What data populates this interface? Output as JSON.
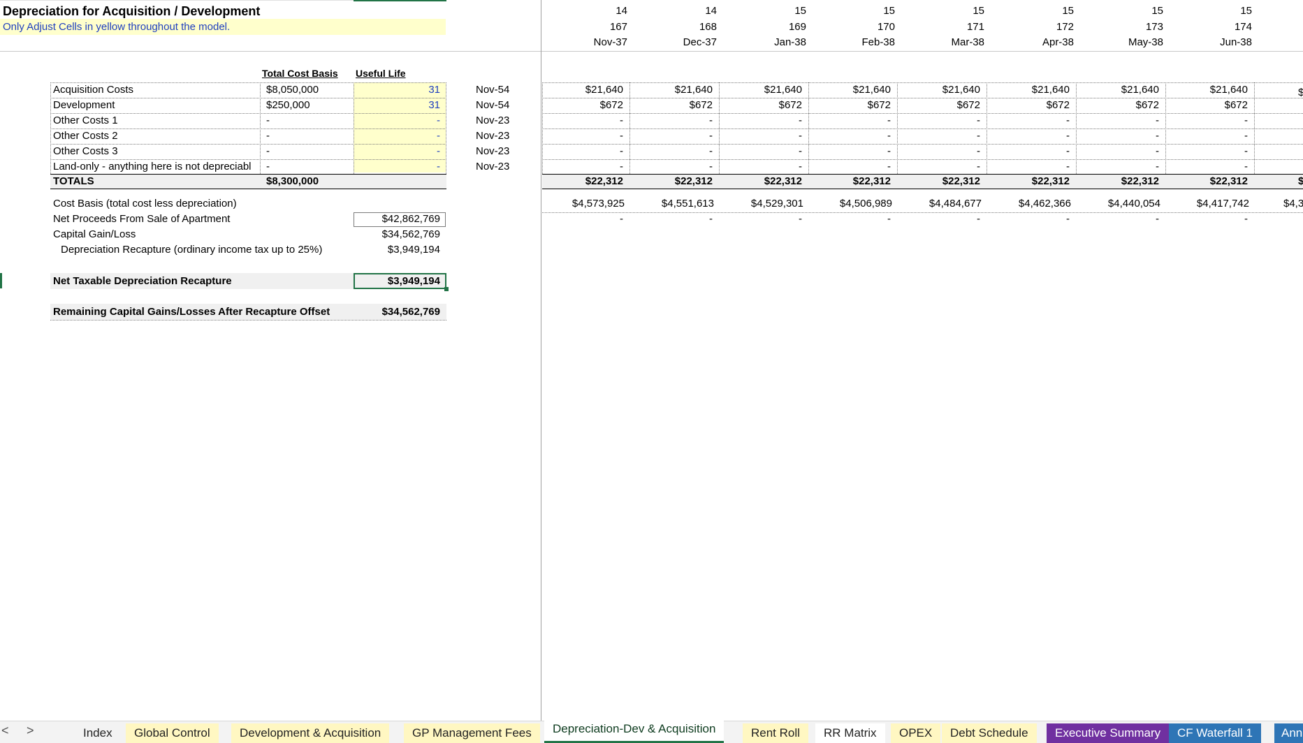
{
  "sheet": {
    "title": "Depreciation for Acquisition / Development",
    "note": "Only Adjust Cells in yellow throughout the model."
  },
  "headers": {
    "total_cost_basis": "Total Cost Basis",
    "useful_life": "Useful Life"
  },
  "periods": [
    {
      "year": "14",
      "month": "167",
      "date": "Nov-37"
    },
    {
      "year": "14",
      "month": "168",
      "date": "Dec-37"
    },
    {
      "year": "15",
      "month": "169",
      "date": "Jan-38"
    },
    {
      "year": "15",
      "month": "170",
      "date": "Feb-38"
    },
    {
      "year": "15",
      "month": "171",
      "date": "Mar-38"
    },
    {
      "year": "15",
      "month": "172",
      "date": "Apr-38"
    },
    {
      "year": "15",
      "month": "173",
      "date": "May-38"
    },
    {
      "year": "15",
      "month": "174",
      "date": "Jun-38"
    }
  ],
  "rows": [
    {
      "label": "Acquisition Costs",
      "basis": "$8,050,000",
      "life": "31",
      "end": "Nov-54",
      "monthly": "$21,640"
    },
    {
      "label": "Development",
      "basis": "$250,000",
      "life": "31",
      "end": "Nov-54",
      "monthly": "$672"
    },
    {
      "label": "Other Costs 1",
      "basis": "-",
      "life": "-",
      "end": "Nov-23",
      "monthly": "-"
    },
    {
      "label": "Other Costs 2",
      "basis": "-",
      "life": "-",
      "end": "Nov-23",
      "monthly": "-"
    },
    {
      "label": "Other Costs 3",
      "basis": "-",
      "life": "-",
      "end": "Nov-23",
      "monthly": "-"
    },
    {
      "label": "Land-only - anything here is not depreciabl",
      "basis": "-",
      "life": "-",
      "end": "Nov-23",
      "monthly": "-"
    }
  ],
  "totals": {
    "label": "TOTALS",
    "basis": "$8,300,000",
    "monthly": "$22,312",
    "partial": "$"
  },
  "cost_basis": {
    "label": "Cost Basis (total cost less depreciation)",
    "values": [
      "$4,573,925",
      "$4,551,613",
      "$4,529,301",
      "$4,506,989",
      "$4,484,677",
      "$4,462,366",
      "$4,440,054",
      "$4,417,742"
    ],
    "partial": "$4,3"
  },
  "partial_row_value": "$",
  "net_proceeds": {
    "label": "Net Proceeds From Sale of Apartment",
    "value": "$42,862,769",
    "period_value": "-"
  },
  "capital_gain": {
    "label": "Capital Gain/Loss",
    "value": "$34,562,769"
  },
  "recapture": {
    "label": "Depreciation Recapture (ordinary income tax up to 25%)",
    "value": "$3,949,194"
  },
  "net_taxable": {
    "label": "Net Taxable Depreciation Recapture",
    "value": "$3,949,194"
  },
  "remaining": {
    "label": "Remaining Capital Gains/Losses After Recapture Offset",
    "value": "$34,562,769"
  },
  "tabs": [
    {
      "label": "Index",
      "style": "plain"
    },
    {
      "label": "Global Control",
      "style": "yellow"
    },
    {
      "label": "Development & Acquisition",
      "style": "yellow"
    },
    {
      "label": "GP Management Fees",
      "style": "yellow"
    },
    {
      "label": "Depreciation-Dev & Acquisition",
      "style": "active"
    },
    {
      "label": "Rent Roll",
      "style": "yellow"
    },
    {
      "label": "RR Matrix",
      "style": "white"
    },
    {
      "label": "OPEX",
      "style": "yellow"
    },
    {
      "label": "Debt Schedule",
      "style": "yellow"
    },
    {
      "label": "Executive Summary",
      "style": "purple"
    },
    {
      "label": "CF Waterfall 1",
      "style": "blue"
    },
    {
      "label": "Ann",
      "style": "blue"
    }
  ],
  "nav": {
    "prev": "<",
    "next": ">"
  }
}
